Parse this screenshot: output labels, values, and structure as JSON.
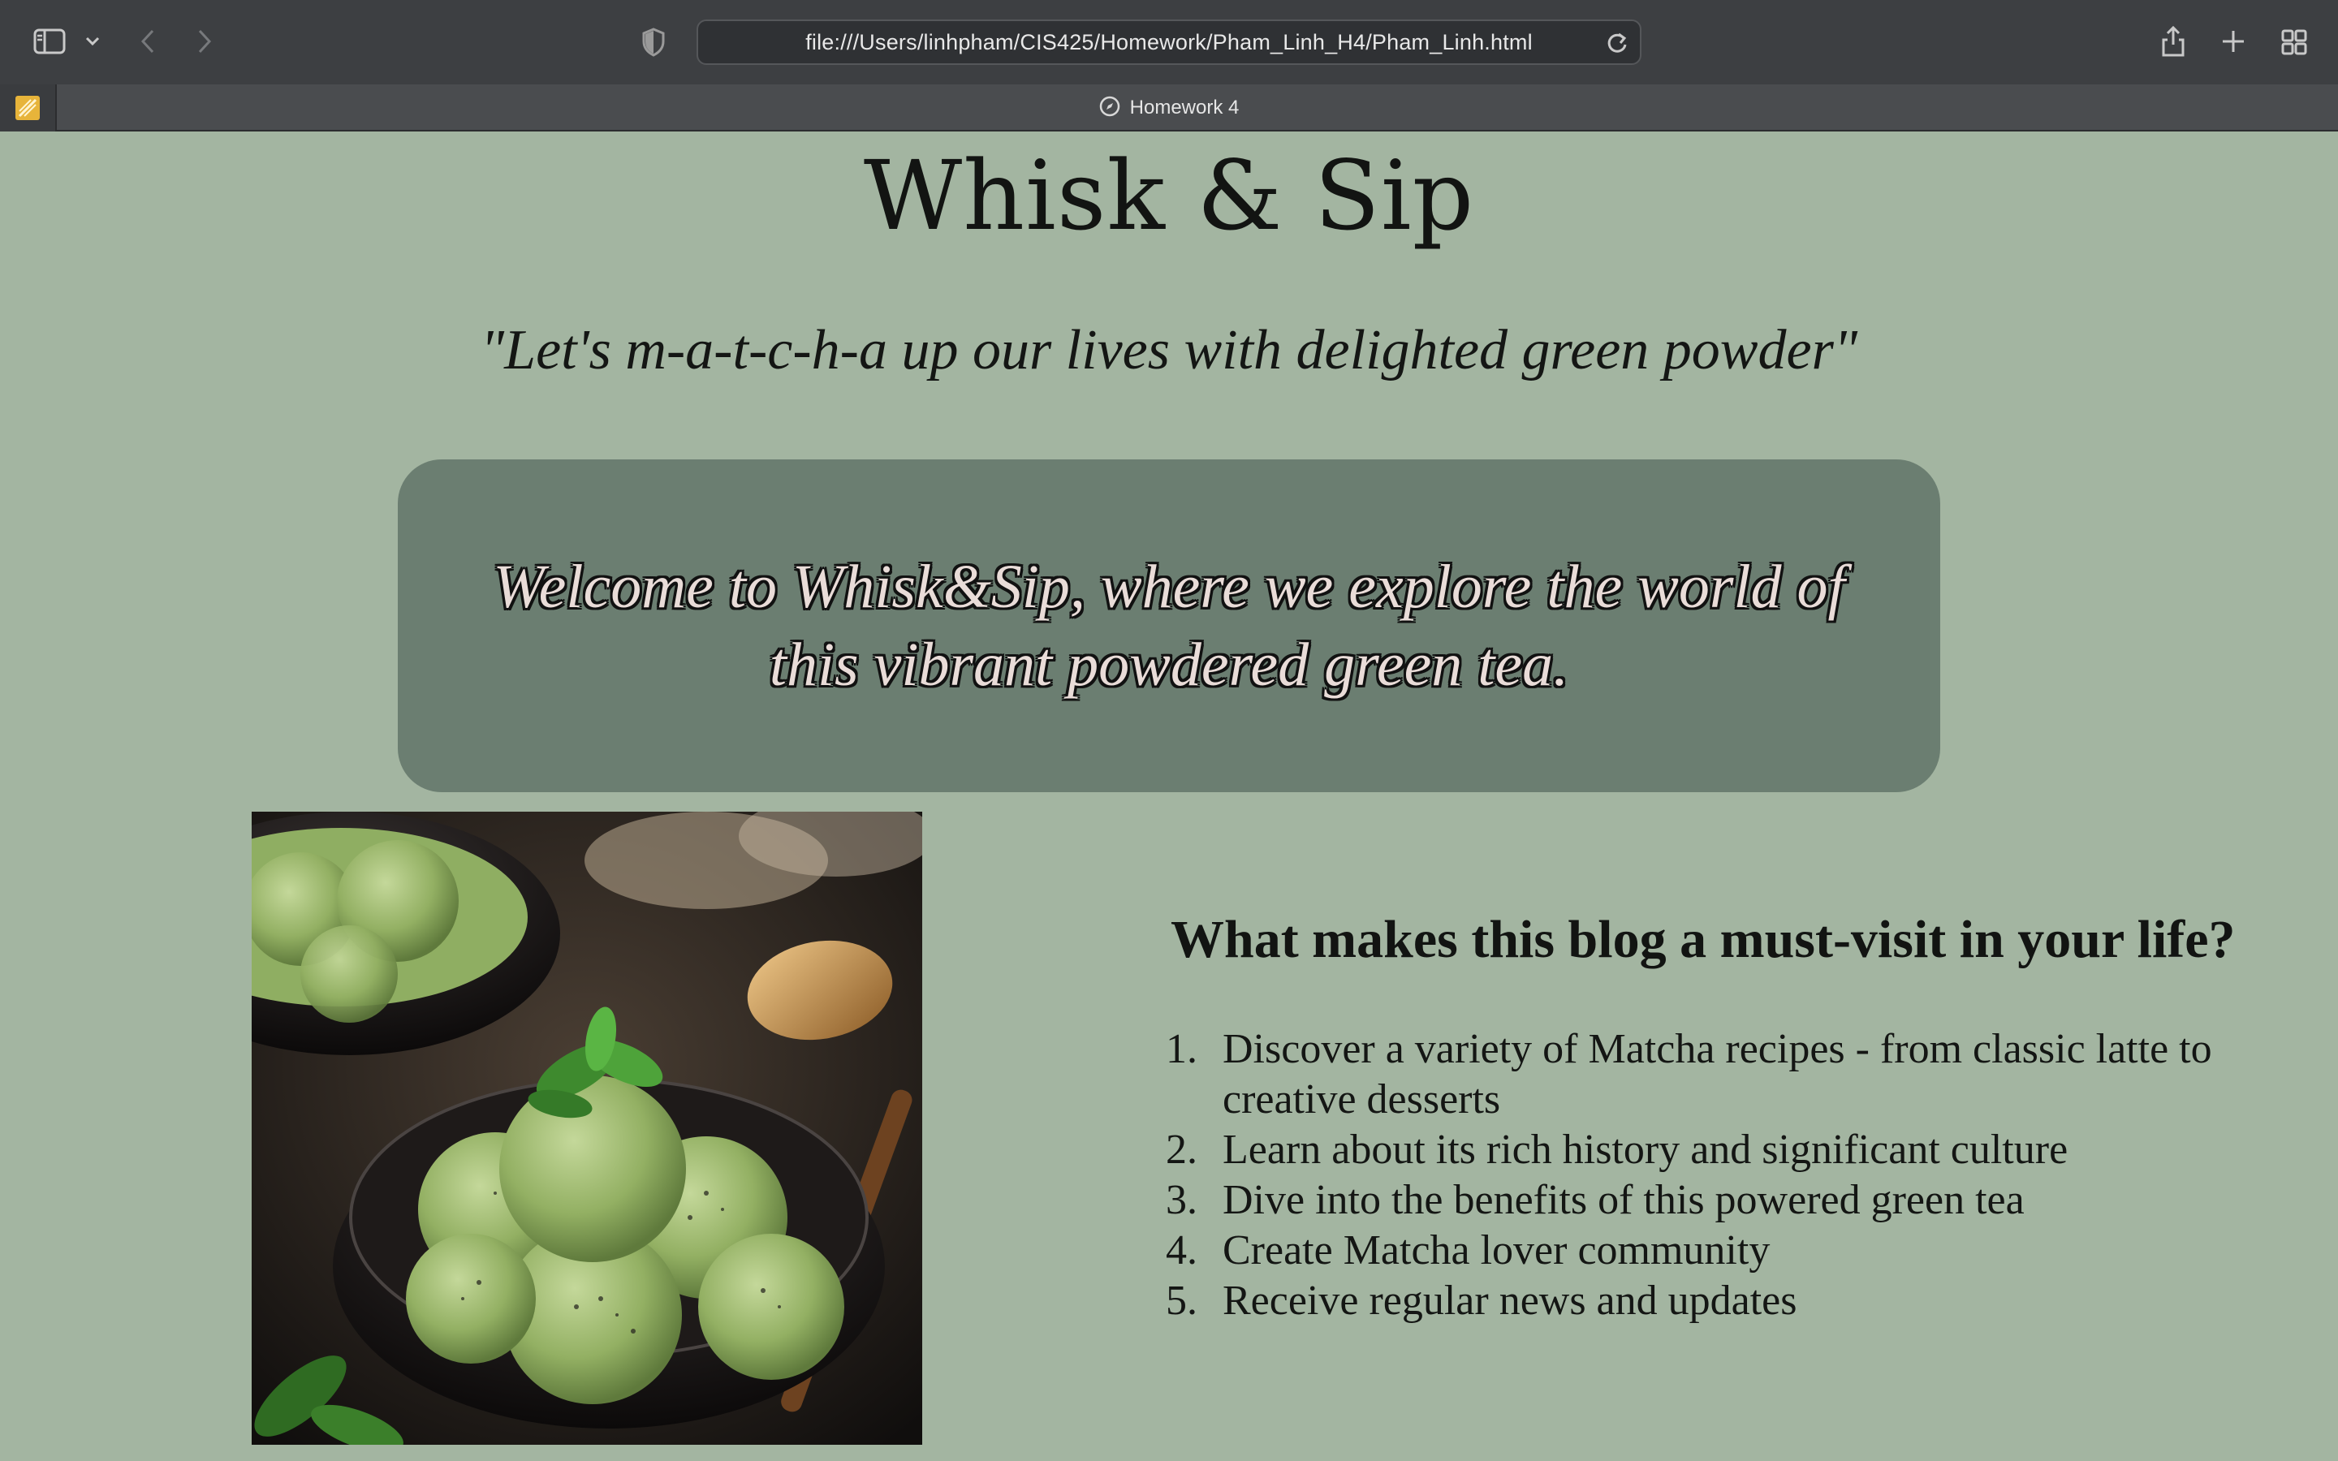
{
  "browser": {
    "url": "file:///Users/linhpham/CIS425/Homework/Pham_Linh_H4/Pham_Linh.html",
    "tab_title": "Homework 4",
    "icons": {
      "sidebar": "sidebar-icon",
      "dropdown": "chevron-down-icon",
      "back": "back-arrow-icon",
      "forward": "forward-arrow-icon",
      "privacy": "shield-icon",
      "reload": "reload-icon",
      "share": "share-icon",
      "new_tab": "plus-icon",
      "tab_overview": "grid-icon",
      "pinned_tab": "pinned-tab-favicon",
      "tab_favicon": "compass-icon"
    }
  },
  "page": {
    "title": "Whisk & Sip",
    "tagline": "\"Let's m-a-t-c-h-a up our lives with delighted green powder\"",
    "welcome": "Welcome to Whisk&Sip, where we explore the world of this vibrant powdered green tea.",
    "features_heading": "What makes this blog a must-visit in your life?",
    "features": [
      {
        "num": "1.",
        "text": "Discover a variety of Matcha recipes - from classic latte to creative desserts"
      },
      {
        "num": "2.",
        "text": "Learn about its rich history and significant culture"
      },
      {
        "num": "3.",
        "text": "Dive into the benefits of this powered green tea"
      },
      {
        "num": "4.",
        "text": "Create Matcha lover community"
      },
      {
        "num": "5.",
        "text": "Receive regular news and updates"
      }
    ]
  },
  "colors": {
    "page_bg": "#a3b5a1",
    "welcome_box": "#6b7e71",
    "welcome_text": "#e9dcd8",
    "toolbar": "#3d3f42"
  }
}
